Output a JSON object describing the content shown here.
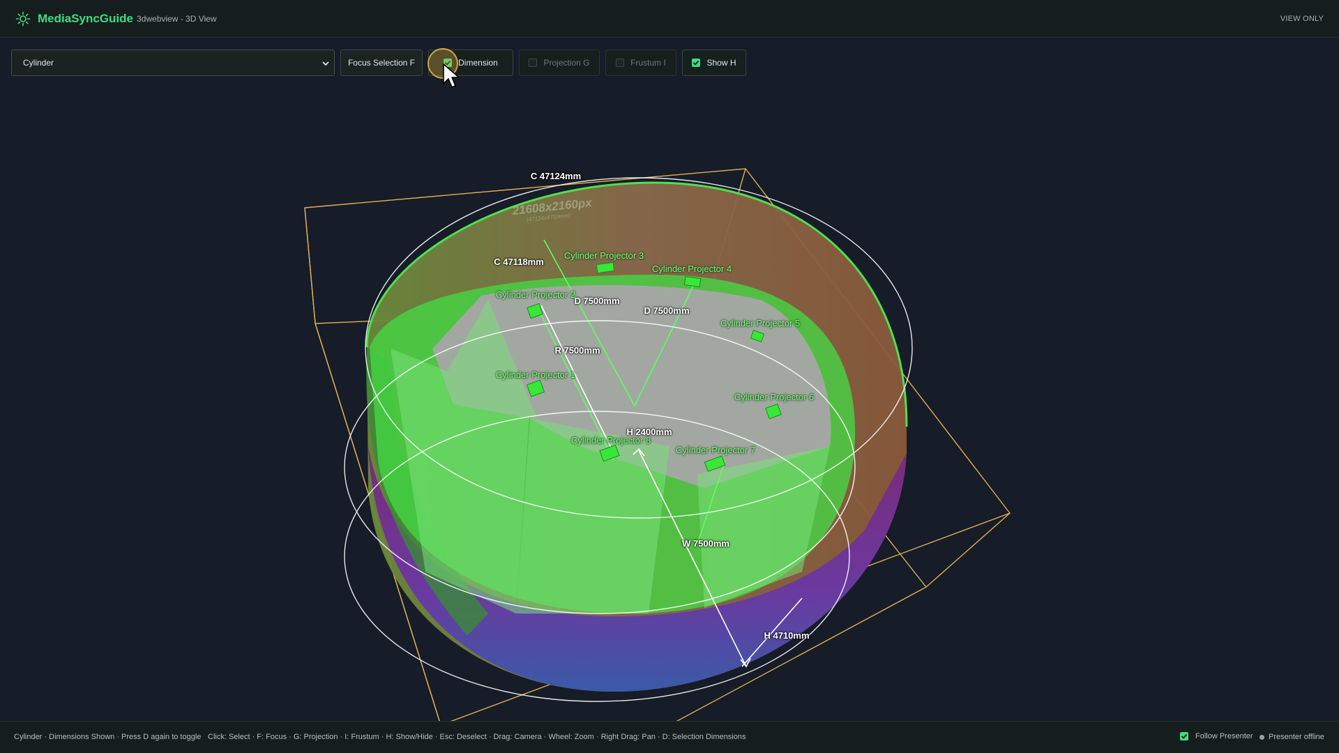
{
  "header": {
    "app_title": "MediaSyncGuide",
    "subtitle": "3dwebview - 3D View",
    "mode": "VIEW ONLY"
  },
  "toolbar": {
    "object_select": {
      "value": "Cylinder"
    },
    "focus_button": "Focus Selection F",
    "toggles": [
      {
        "label": "Dimension",
        "checked": true,
        "enabled": true
      },
      {
        "label": "Projection G",
        "checked": false,
        "enabled": false
      },
      {
        "label": "Frustum I",
        "checked": false,
        "enabled": false
      },
      {
        "label": "Show H",
        "checked": true,
        "enabled": true
      }
    ]
  },
  "scene": {
    "texture_text": {
      "resolution": "21608x2160px",
      "physical": "(47124x4710mm)"
    },
    "dimensions": {
      "outer_circumference": "C 47124mm",
      "inner_circumference": "C 47118mm",
      "diameter_a": "D 7500mm",
      "diameter_b": "D 7500mm",
      "radius": "R 7500mm",
      "inner_height": "H 2400mm",
      "width": "W 7500mm",
      "outer_height": "H 4710mm"
    },
    "projectors": [
      "Cylinder Projector 1",
      "Cylinder Projector 2",
      "Cylinder Projector 3",
      "Cylinder Projector 4",
      "Cylinder Projector 5",
      "Cylinder Projector 6",
      "Cylinder Projector 7",
      "Cylinder Projector 8"
    ],
    "colors": {
      "accent": "#3ddc84",
      "bounding_box": "#e0b050",
      "dimension_line": "#ffffff"
    }
  },
  "footer": {
    "status": "Cylinder · Dimensions Shown · Press D again to toggle",
    "shortcuts": "Click: Select · F: Focus · G: Projection · I: Frustum · H: Show/Hide · Esc: Deselect · Drag: Camera · Wheel: Zoom · Right Drag: Pan · D: Selection Dimensions",
    "follow_presenter": {
      "label": "Follow Presenter",
      "checked": true
    },
    "presenter_status": "Presenter offline"
  }
}
